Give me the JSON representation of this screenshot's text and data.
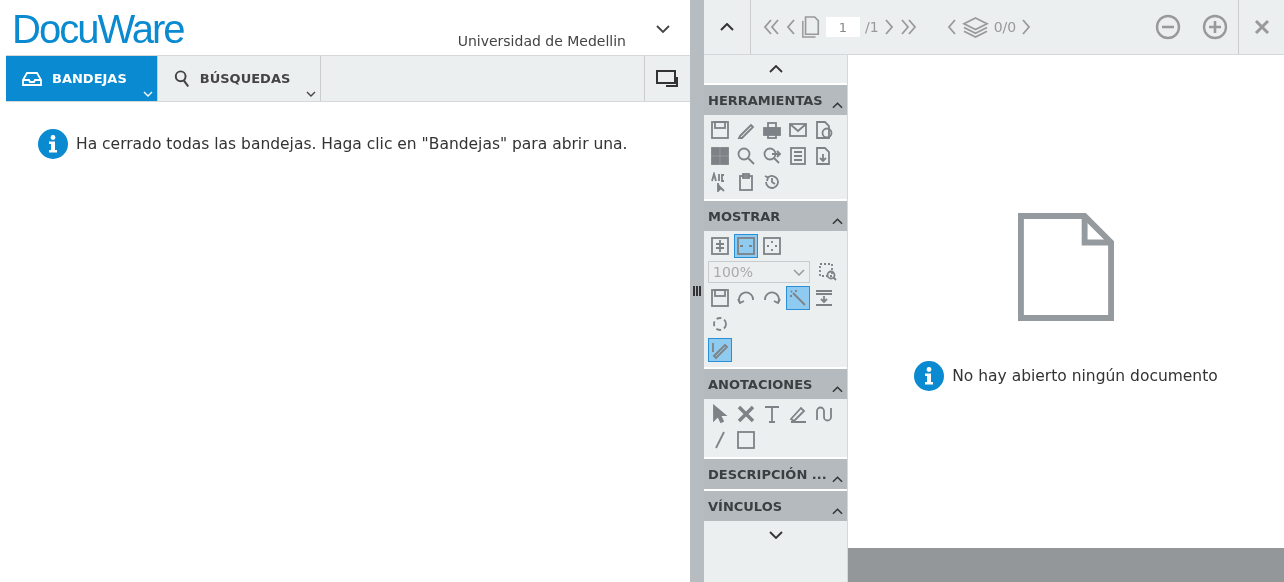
{
  "logo": "DocuWare",
  "organization": "Universidad de Medellin",
  "tabs": [
    {
      "label": "BANDEJAS",
      "kind": "trays",
      "selected": true
    },
    {
      "label": "BÚSQUEDAS",
      "kind": "search",
      "selected": false
    }
  ],
  "left_message": "Ha cerrado todas las bandejas. Haga clic en \"Bandejas\" para abrir una.",
  "viewer_toolbar": {
    "page_field": "1",
    "page_total": "/1",
    "layers": "0/0"
  },
  "sidebar": {
    "sections": [
      {
        "title": "HERRAMIENTAS",
        "rows": [
          [
            {
              "kind": "save",
              "selected": false
            },
            {
              "kind": "pencil",
              "selected": false
            },
            {
              "kind": "print",
              "selected": false
            },
            {
              "kind": "mail",
              "selected": false
            },
            {
              "kind": "doc-info",
              "selected": false
            }
          ],
          [
            {
              "kind": "grid",
              "selected": false
            },
            {
              "kind": "search",
              "selected": false
            },
            {
              "kind": "search-arrow",
              "selected": false
            },
            {
              "kind": "list-doc",
              "selected": false
            },
            {
              "kind": "download-doc",
              "selected": false
            }
          ],
          [
            {
              "kind": "spell",
              "selected": false
            },
            {
              "kind": "clipboard",
              "selected": false
            },
            {
              "kind": "history",
              "selected": false
            }
          ]
        ]
      },
      {
        "title": "MOSTRAR",
        "rows": [
          [
            {
              "kind": "fit-height",
              "selected": false
            },
            {
              "kind": "fit-width",
              "selected": true
            },
            {
              "kind": "fit-page",
              "selected": false
            }
          ],
          [
            {
              "kind": "zoom-select",
              "value": "100%"
            },
            {
              "kind": "zoom-area",
              "selected": false
            }
          ],
          [
            {
              "kind": "save",
              "selected": false
            },
            {
              "kind": "undo",
              "selected": false
            },
            {
              "kind": "redo",
              "selected": false
            },
            {
              "kind": "wand",
              "selected": true
            },
            {
              "kind": "stamp-down",
              "selected": false
            }
          ],
          [
            {
              "kind": "rotate",
              "selected": false
            }
          ],
          [
            {
              "kind": "edit",
              "selected": true
            }
          ]
        ]
      },
      {
        "title": "ANOTACIONES",
        "rows": [
          [
            {
              "kind": "pointer",
              "selected": false
            },
            {
              "kind": "cross",
              "selected": false
            },
            {
              "kind": "text",
              "selected": false
            },
            {
              "kind": "highlighter",
              "selected": false
            },
            {
              "kind": "curve",
              "selected": false
            }
          ],
          [
            {
              "kind": "line",
              "selected": false
            },
            {
              "kind": "rect",
              "selected": false
            }
          ]
        ]
      },
      {
        "title": "DESCRIPCIÓN ..."
      },
      {
        "title": "VÍNCULOS"
      }
    ]
  },
  "viewer_message": "No hay abierto ningún documento"
}
